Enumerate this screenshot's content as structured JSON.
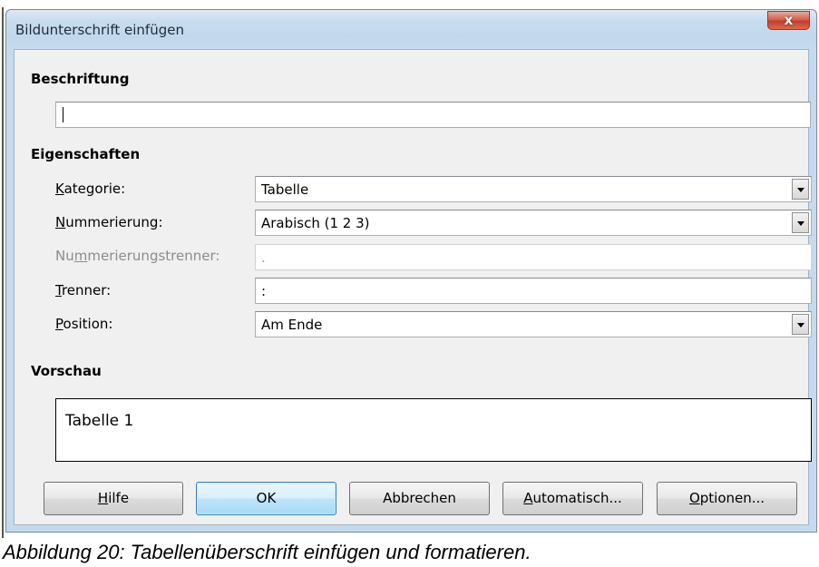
{
  "window": {
    "title": "Bildunterschrift einfügen",
    "close_symbol": "x"
  },
  "caption_section": {
    "title": "Beschriftung",
    "input_value": ""
  },
  "properties": {
    "title": "Eigenschaften",
    "category": {
      "label_underlined": "K",
      "label_rest": "ategorie:",
      "value": "Tabelle"
    },
    "numbering": {
      "label_underlined": "N",
      "label_rest": "ummerierung:",
      "value": "Arabisch (1 2 3)"
    },
    "numbering_separator": {
      "label_pre": "Nu",
      "label_underlined": "m",
      "label_rest": "merierungstrenner:",
      "value": "."
    },
    "separator": {
      "label_underlined": "T",
      "label_rest": "renner:",
      "value": ":"
    },
    "position": {
      "label_underlined": "P",
      "label_rest": "osition:",
      "value": "Am Ende"
    }
  },
  "preview": {
    "title": "Vorschau",
    "text": "Tabelle 1"
  },
  "buttons": {
    "help": {
      "underlined": "H",
      "rest": "ilfe"
    },
    "ok": {
      "label": "OK"
    },
    "cancel": {
      "label": "Abbrechen"
    },
    "auto": {
      "underlined": "A",
      "rest": "utomatisch..."
    },
    "options": {
      "underlined": "O",
      "rest": "ptionen..."
    }
  },
  "figure_caption": "Abbildung 20: Tabellenüberschrift einfügen und formatieren."
}
